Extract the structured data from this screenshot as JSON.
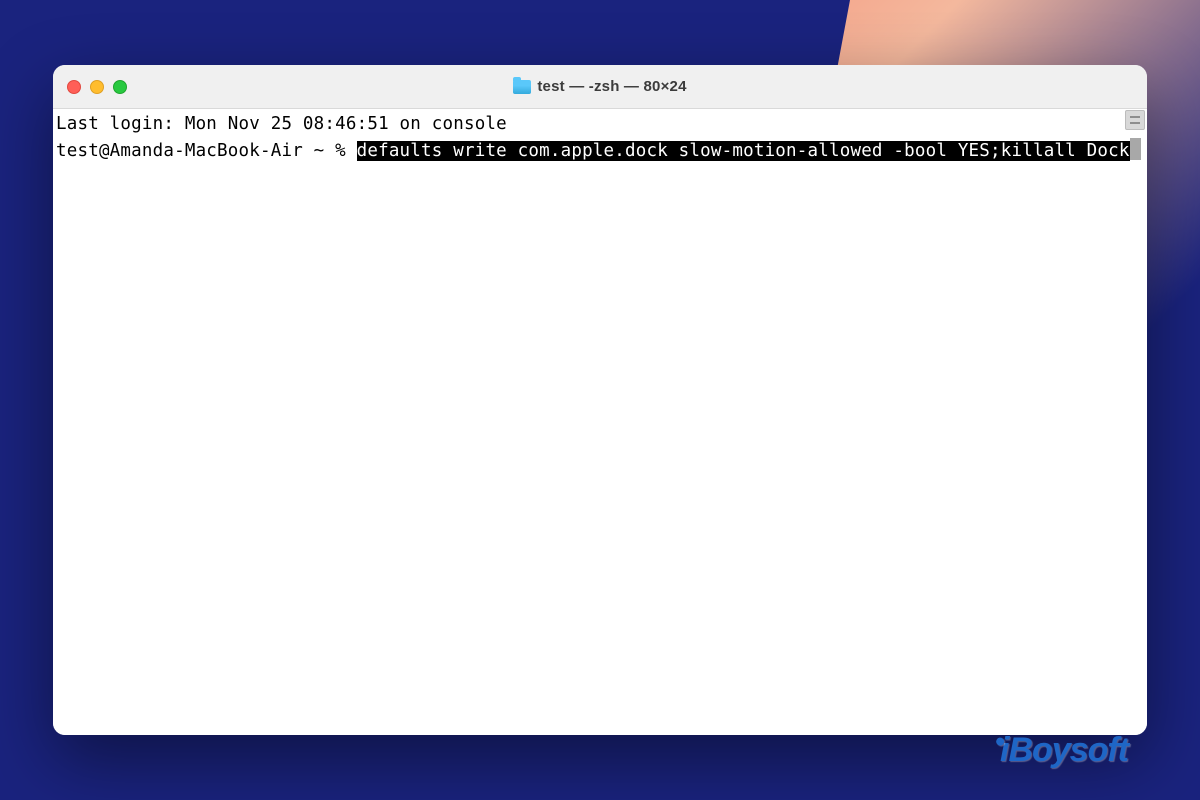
{
  "window": {
    "title": "test — -zsh — 80×24"
  },
  "terminal": {
    "last_login_line": "Last login: Mon Nov 25 08:46:51 on console",
    "prompt": "test@Amanda-MacBook-Air ~ % ",
    "command_selected": "defaults write com.apple.dock slow-motion-allowed -bool YES;killall Dock"
  },
  "watermark": {
    "text": "iBoysoft"
  },
  "colors": {
    "desktop_bg": "#1a237e",
    "window_bg": "#ffffff",
    "titlebar_bg": "#f0f0f0",
    "traffic_close": "#ff5f57",
    "traffic_min": "#ffbd2e",
    "traffic_max": "#28c940",
    "selection_bg": "#000000",
    "selection_fg": "#ffffff"
  }
}
